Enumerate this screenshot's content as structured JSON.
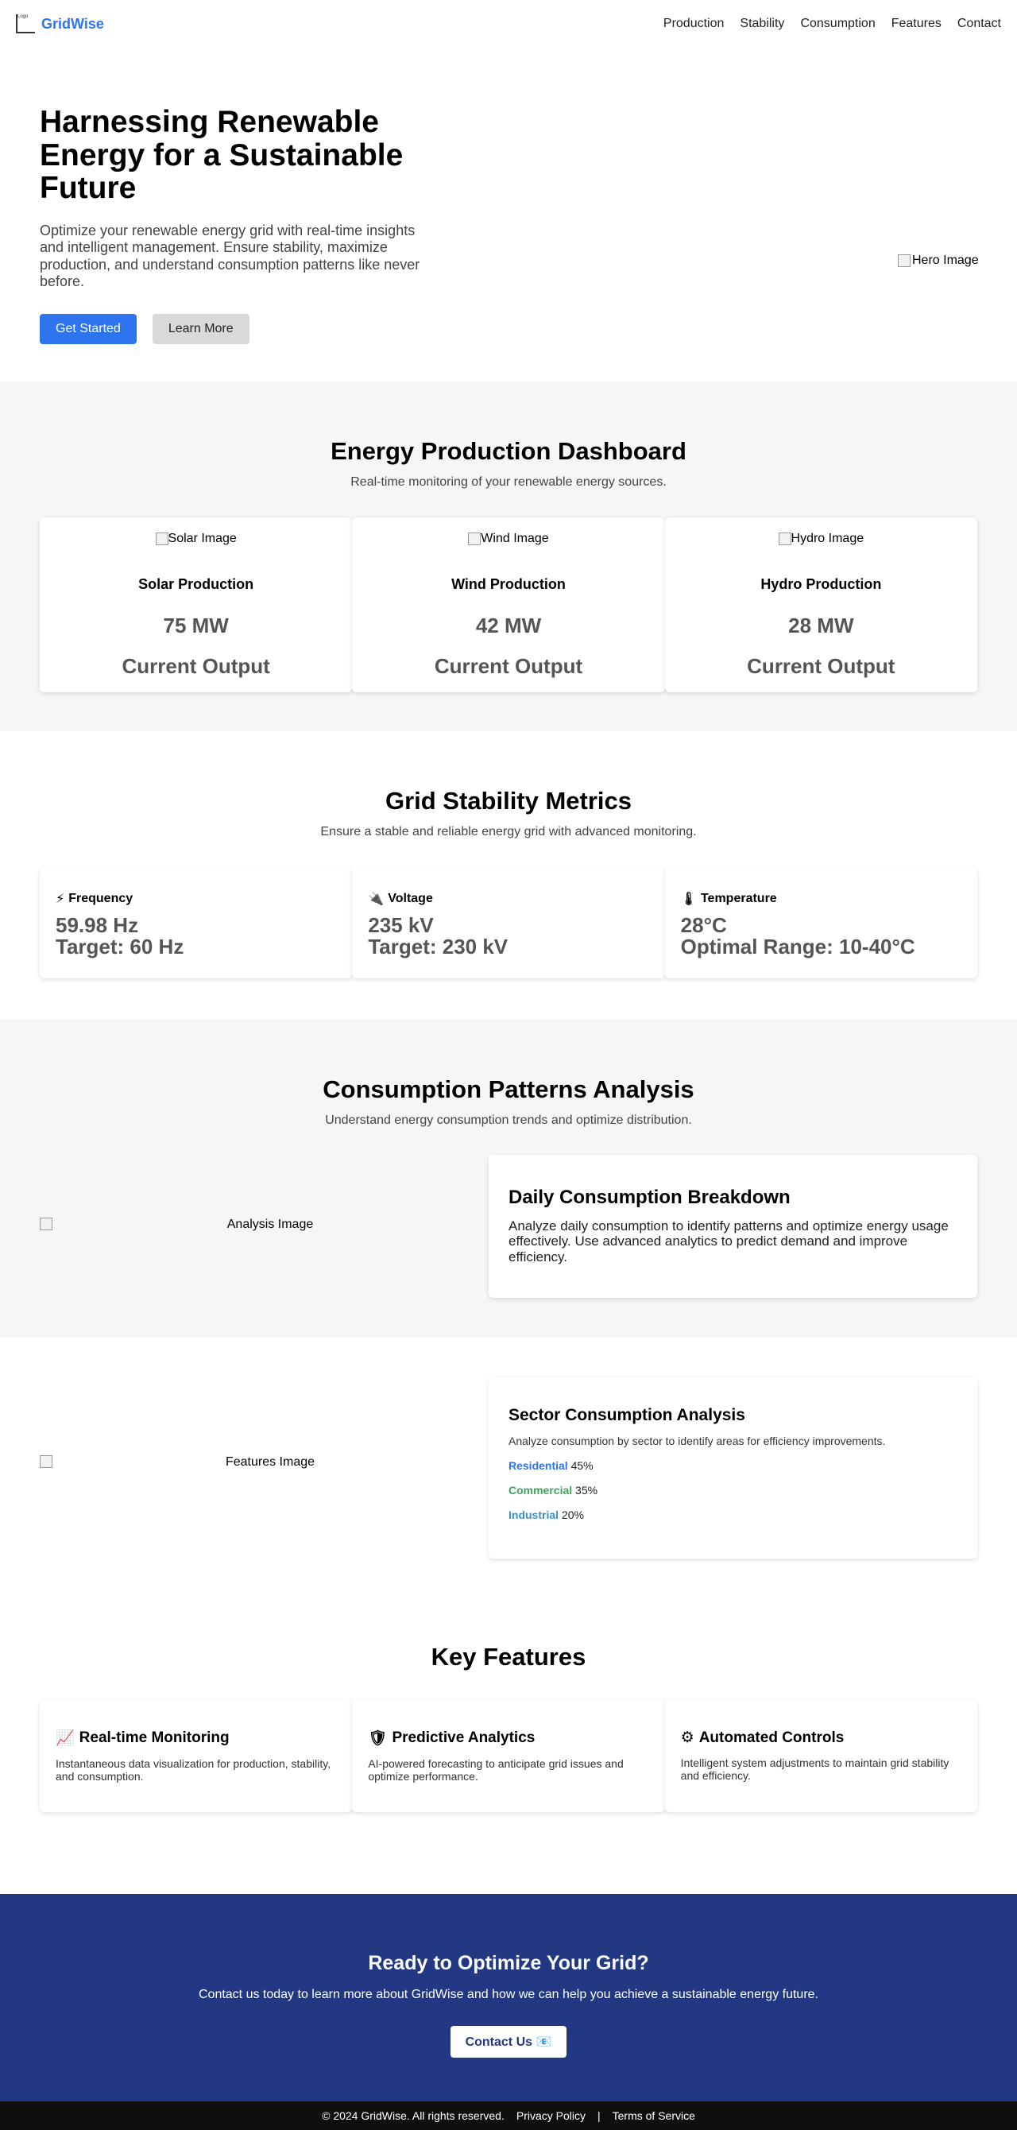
{
  "header": {
    "logo_alt": "Logo",
    "brand": "GridWise",
    "nav": [
      "Production",
      "Stability",
      "Consumption",
      "Features",
      "Contact"
    ]
  },
  "hero": {
    "title": "Harnessing Renewable Energy for a Sustainable Future",
    "text": "Optimize your renewable energy grid with real-time insights and intelligent management. Ensure stability, maximize production, and understand consumption patterns like never before.",
    "primary_button": "Get Started",
    "secondary_button": "Learn More",
    "image_alt": "Hero Image"
  },
  "production": {
    "title": "Energy Production Dashboard",
    "subtitle": "Real-time monitoring of your renewable energy sources.",
    "cards": [
      {
        "image_alt": "Solar Image",
        "name": "Solar Production",
        "value": "75 MW",
        "label": "Current Output"
      },
      {
        "image_alt": "Wind Image",
        "name": "Wind Production",
        "value": "42 MW",
        "label": "Current Output"
      },
      {
        "image_alt": "Hydro Image",
        "name": "Hydro Production",
        "value": "28 MW",
        "label": "Current Output"
      }
    ]
  },
  "stability": {
    "title": "Grid Stability Metrics",
    "subtitle": "Ensure a stable and reliable energy grid with advanced monitoring.",
    "cards": [
      {
        "icon": "⚡",
        "icon_name": "lightning-icon",
        "name": "Frequency",
        "value": "59.98 Hz",
        "target": "Target: 60 Hz"
      },
      {
        "icon": "🔌",
        "icon_name": "plug-icon",
        "name": "Voltage",
        "value": "235 kV",
        "target": "Target: 230 kV"
      },
      {
        "icon": "🌡",
        "icon_name": "thermometer-icon",
        "name": "Temperature",
        "value": "28°C",
        "target": "Optimal Range: 10-40°C"
      }
    ]
  },
  "consumption": {
    "title": "Consumption Patterns Analysis",
    "subtitle": "Understand energy consumption trends and optimize distribution.",
    "image_alt": "Analysis Image",
    "card_title": "Daily Consumption Breakdown",
    "card_text": "Analyze daily consumption to identify patterns and optimize energy usage effectively. Use advanced analytics to predict demand and improve efficiency."
  },
  "sector": {
    "image_alt": "Features Image",
    "title": "Sector Consumption Analysis",
    "text": "Analyze consumption by sector to identify areas for efficiency improvements.",
    "rows": [
      {
        "name": "Residential",
        "value": "45%",
        "color": "#2f74ef"
      },
      {
        "name": "Commercial",
        "value": "35%",
        "color": "#3aa65a"
      },
      {
        "name": "Industrial",
        "value": "20%",
        "color": "#3b8fc8"
      }
    ]
  },
  "features": {
    "title": "Key Features",
    "cards": [
      {
        "icon": "📈",
        "icon_name": "chart-up-icon",
        "name": "Real-time Monitoring",
        "text": "Instantaneous data visualization for production, stability, and consumption."
      },
      {
        "icon": "🛡",
        "icon_name": "shield-icon",
        "name": "Predictive Analytics",
        "text": "AI-powered forecasting to anticipate grid issues and optimize performance."
      },
      {
        "icon": "⚙",
        "icon_name": "gear-icon",
        "name": "Automated Controls",
        "text": "Intelligent system adjustments to maintain grid stability and efficiency."
      }
    ]
  },
  "cta": {
    "title": "Ready to Optimize Your Grid?",
    "text": "Contact us today to learn more about GridWise and how we can help you achieve a sustainable energy future.",
    "button": "Contact Us",
    "button_icon": "📧"
  },
  "footer": {
    "copyright": "© 2024 GridWise. All rights reserved.",
    "privacy": "Privacy Policy",
    "separator": "|",
    "terms": "Terms of Service"
  },
  "colors": {
    "accent": "#2f74ef",
    "cta_background": "#233883",
    "footer_background": "#0f0f0f"
  }
}
